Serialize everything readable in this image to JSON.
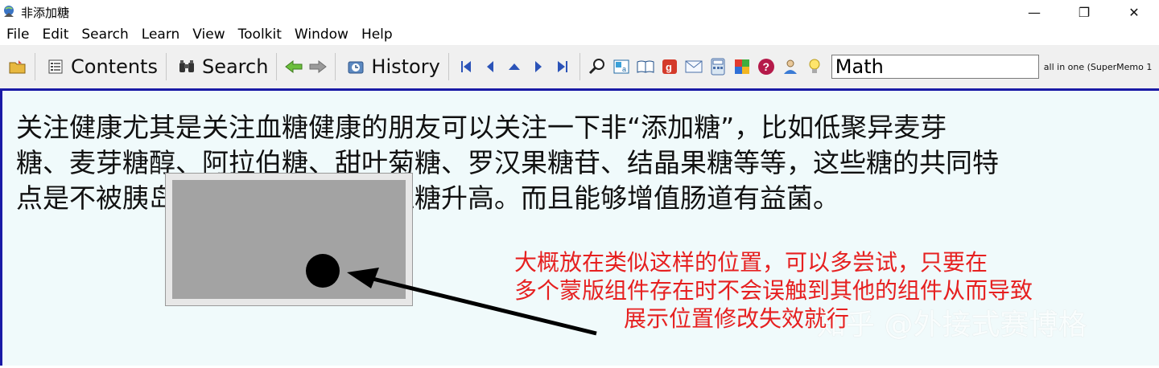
{
  "window": {
    "title": "非添加糖",
    "minimize_label": "—",
    "maximize_label": "❐",
    "close_label": "✕"
  },
  "menu": {
    "items": [
      {
        "label": "File"
      },
      {
        "label": "Edit"
      },
      {
        "label": "Search"
      },
      {
        "label": "Learn"
      },
      {
        "label": "View"
      },
      {
        "label": "Toolkit"
      },
      {
        "label": "Window"
      },
      {
        "label": "Help"
      }
    ]
  },
  "toolbar": {
    "contents_label": "Contents",
    "search_label": "Search",
    "history_label": "History",
    "search_value": "Math",
    "collection_label": "all in one (SuperMemo 1"
  },
  "content": {
    "lines": [
      "关注健康尤其是关注血糖健康的朋友可以关注一下非“添加糖”，比如低聚异麦芽",
      "糖、麦芽糖醇、阿拉伯糖、甜叶菊糖、罗汉果糖苷、结晶果糖等等，这些糖的共同特",
      "点是不被胰岛素吸收，不会引起血糖升高。而且能够增值肠道有益菌。"
    ],
    "note_lines": [
      "大概放在类似这样的位置，可以多尝试，只要在",
      "多个蒙版组件存在时不会误触到其他的组件从而导致",
      "展示位置修改失效就行"
    ],
    "watermark": "知乎 @外接式赛博格"
  },
  "colors": {
    "note": "#e62020",
    "content_bg": "#f0fafb",
    "frame": "#1a1aa6"
  }
}
